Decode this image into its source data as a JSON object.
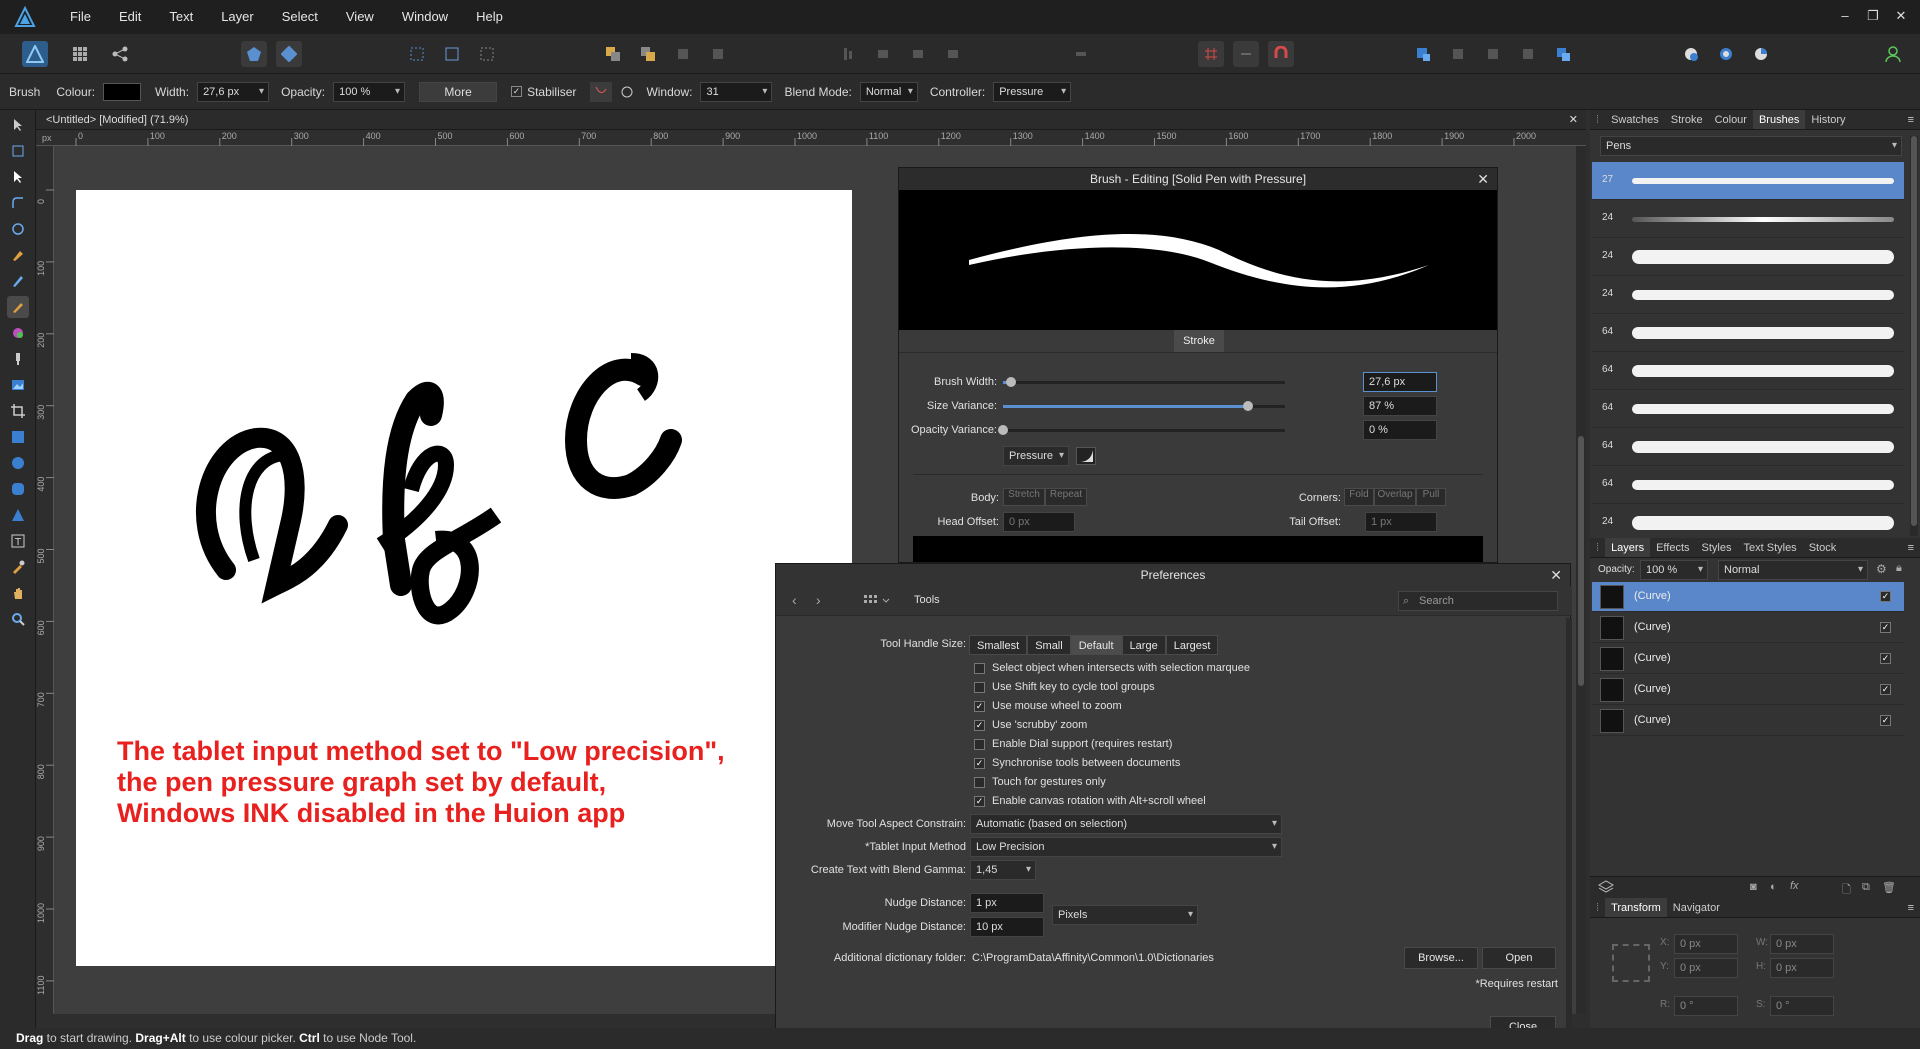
{
  "menu": [
    "File",
    "Edit",
    "Text",
    "Layer",
    "Select",
    "View",
    "Window",
    "Help"
  ],
  "context": {
    "tool": "Brush",
    "colour_label": "Colour:",
    "width_label": "Width:",
    "width_value": "27,6 px",
    "opacity_label": "Opacity:",
    "opacity_value": "100 %",
    "more": "More",
    "stabiliser": "Stabiliser",
    "window_label": "Window:",
    "window_value": "31",
    "blend_label": "Blend Mode:",
    "blend_value": "Normal",
    "controller_label": "Controller:",
    "controller_value": "Pressure"
  },
  "doc_tab": "<Untitled> [Modified] (71.9%)",
  "ruler": {
    "px": "px",
    "h": [
      "0",
      "100",
      "200",
      "300",
      "400",
      "500",
      "600",
      "700",
      "800",
      "900",
      "1000",
      "1100",
      "1200",
      "1300",
      "1400",
      "1500",
      "1600",
      "1700",
      "1800",
      "1900",
      "2000"
    ],
    "v": [
      "0",
      "100",
      "200",
      "300",
      "400",
      "500",
      "600",
      "700",
      "800",
      "900",
      "1000",
      "1100"
    ]
  },
  "note": [
    "The tablet input method set to \"Low precision\",",
    "the pen pressure graph set by default,",
    "Windows INK disabled in the Huion app"
  ],
  "brush_dialog": {
    "title": "Brush - Editing [Solid Pen with Pressure]",
    "tab": "Stroke",
    "brush_width_label": "Brush Width:",
    "brush_width_value": "27,6 px",
    "brush_width_level": 0.03,
    "size_var_label": "Size Variance:",
    "size_var_value": "87 %",
    "size_var_level": 0.87,
    "opacity_var_label": "Opacity Variance:",
    "opacity_var_value": "0 %",
    "opacity_var_level": 0,
    "controller": "Pressure",
    "body_label": "Body:",
    "body_opts": [
      "Stretch",
      "Repeat"
    ],
    "corners_label": "Corners:",
    "corners_opts": [
      "Fold",
      "Overlap",
      "Pull"
    ],
    "head_label": "Head Offset:",
    "head_value": "0 px",
    "tail_label": "Tail Offset:",
    "tail_value": "1 px"
  },
  "preferences": {
    "title": "Preferences",
    "section": "Tools",
    "search": "Search",
    "handle_label": "Tool Handle Size:",
    "handle_opts": [
      "Smallest",
      "Small",
      "Default",
      "Large",
      "Largest"
    ],
    "handle_selected": "Default",
    "checks": [
      {
        "label": "Select object when intersects with selection marquee",
        "checked": false
      },
      {
        "label": "Use Shift key to cycle tool groups",
        "checked": false
      },
      {
        "label": "Use mouse wheel to zoom",
        "checked": true
      },
      {
        "label": "Use 'scrubby' zoom",
        "checked": true
      },
      {
        "label": "Enable Dial support (requires restart)",
        "checked": false
      },
      {
        "label": "Synchronise tools between documents",
        "checked": true
      },
      {
        "label": "Touch for gestures only",
        "checked": false
      },
      {
        "label": "Enable canvas rotation with Alt+scroll wheel",
        "checked": true
      }
    ],
    "move_label": "Move Tool Aspect Constrain:",
    "move_value": "Automatic (based on selection)",
    "tablet_label": "*Tablet Input Method",
    "tablet_value": "Low Precision",
    "gamma_label": "Create Text with Blend Gamma:",
    "gamma_value": "1,45",
    "nudge_label": "Nudge Distance:",
    "nudge_value": "1 px",
    "mod_nudge_label": "Modifier Nudge Distance:",
    "mod_nudge_value": "10 px",
    "units": "Pixels",
    "dict_label": "Additional dictionary folder:",
    "dict_value": "C:\\ProgramData\\Affinity\\Common\\1.0\\Dictionaries",
    "browse": "Browse...",
    "open": "Open",
    "restart_note": "*Requires restart",
    "close": "Close"
  },
  "right_top_tabs": [
    "Swatches",
    "Stroke",
    "Colour",
    "Brushes",
    "History"
  ],
  "brush_category": "Pens",
  "brush_sizes": [
    "27",
    "24",
    "24",
    "24",
    "64",
    "64",
    "64",
    "64",
    "64",
    "24"
  ],
  "layers_tabs": [
    "Layers",
    "Effects",
    "Styles",
    "Text Styles",
    "Stock"
  ],
  "layers_opacity_label": "Opacity:",
  "layers_opacity": "100 %",
  "layers_blend": "Normal",
  "layers": [
    "(Curve)",
    "(Curve)",
    "(Curve)",
    "(Curve)",
    "(Curve)"
  ],
  "transform_tabs": [
    "Transform",
    "Navigator"
  ],
  "transform": {
    "x": "0 px",
    "y": "0 px",
    "w": "0 px",
    "h": "0 px",
    "r": "0 °",
    "s": "0 °",
    "xl": "X:",
    "yl": "Y:",
    "wl": "W:",
    "hl": "H:",
    "rl": "R:",
    "sl": "S:"
  },
  "status": {
    "a": "Drag",
    "b": " to start drawing. ",
    "c": "Drag+Alt",
    "d": " to use colour picker. ",
    "e": "Ctrl",
    "f": " to use Node Tool."
  }
}
